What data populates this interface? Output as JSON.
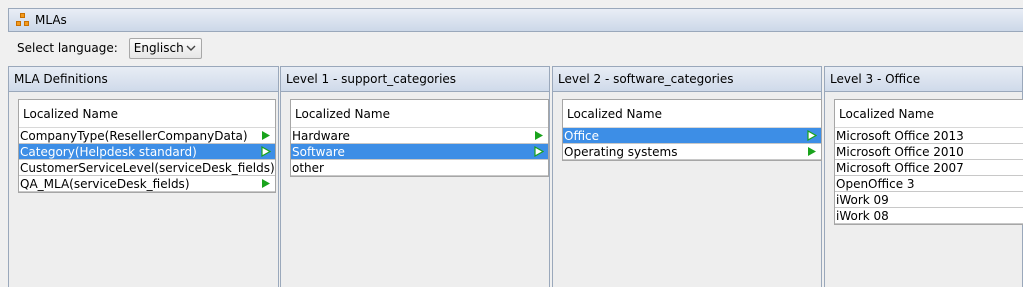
{
  "window": {
    "title": "MLAs",
    "title_icon": "hierarchy-icon"
  },
  "language": {
    "label": "Select language:",
    "selected": "Englisch"
  },
  "colors": {
    "selection": "#3d8ee6",
    "arrow": "#19a31c"
  },
  "panels": [
    {
      "header": "MLA Definitions",
      "column": "Localized Name",
      "rows": [
        {
          "label": "CompanyType(ResellerCompanyData)",
          "arrow": true,
          "selected": false
        },
        {
          "label": "Category(Helpdesk standard)",
          "arrow": true,
          "selected": true
        },
        {
          "label": "CustomerServiceLevel(serviceDesk_fields)",
          "arrow": false,
          "selected": false
        },
        {
          "label": "QA_MLA(serviceDesk_fields)",
          "arrow": true,
          "selected": false
        }
      ]
    },
    {
      "header": "Level 1 - support_categories",
      "column": "Localized Name",
      "rows": [
        {
          "label": "Hardware",
          "arrow": true,
          "selected": false
        },
        {
          "label": "Software",
          "arrow": true,
          "selected": true
        },
        {
          "label": "other",
          "arrow": false,
          "selected": false
        }
      ]
    },
    {
      "header": "Level 2 - software_categories",
      "column": "Localized Name",
      "rows": [
        {
          "label": "Office",
          "arrow": true,
          "selected": true
        },
        {
          "label": "Operating systems",
          "arrow": true,
          "selected": false
        }
      ]
    },
    {
      "header": "Level 3 - Office",
      "column": "Localized Name",
      "rows": [
        {
          "label": "Microsoft Office 2013",
          "arrow": false,
          "selected": false
        },
        {
          "label": "Microsoft Office 2010",
          "arrow": false,
          "selected": false
        },
        {
          "label": "Microsoft Office 2007",
          "arrow": false,
          "selected": false
        },
        {
          "label": "OpenOffice 3",
          "arrow": false,
          "selected": false
        },
        {
          "label": "iWork 09",
          "arrow": false,
          "selected": false
        },
        {
          "label": "iWork 08",
          "arrow": false,
          "selected": false
        }
      ]
    }
  ]
}
